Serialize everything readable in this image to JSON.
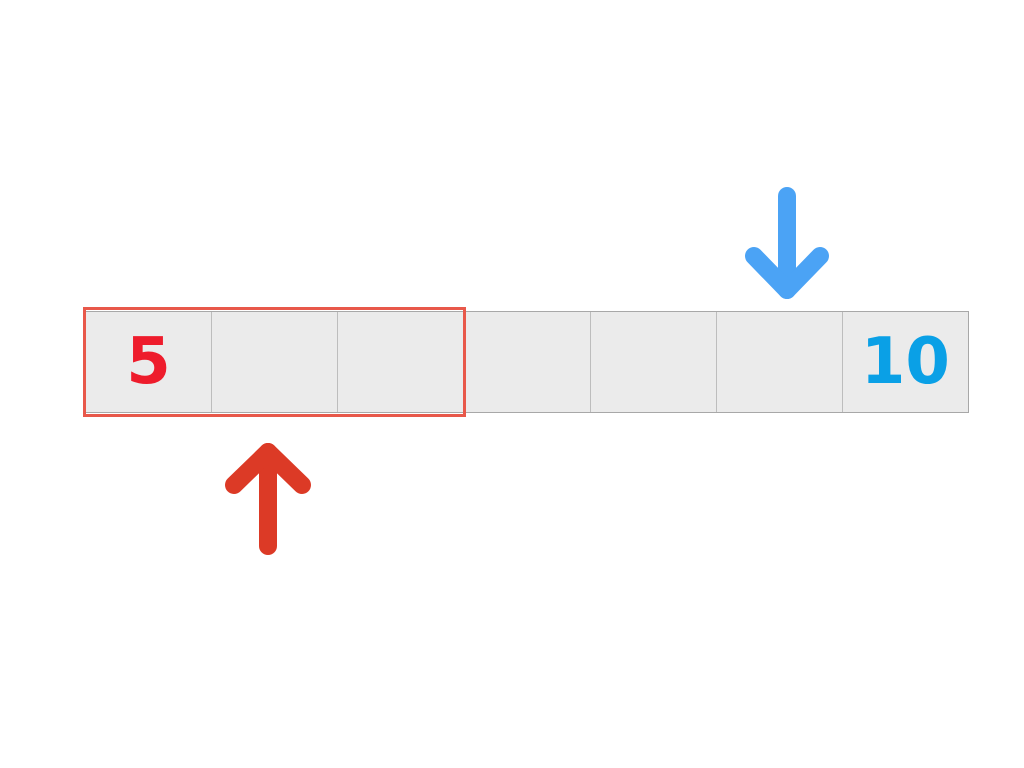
{
  "cells": [
    {
      "value": "5"
    },
    {
      "value": ""
    },
    {
      "value": ""
    },
    {
      "value": ""
    },
    {
      "value": ""
    },
    {
      "value": ""
    },
    {
      "value": "10"
    }
  ],
  "colors": {
    "cell_fill": "#ebebeb",
    "cell_border": "#bdbdbd",
    "left_value": "#ee1c2c",
    "right_value": "#0aa0e6",
    "highlight_box": "#e8584a",
    "up_arrow": "#dc3a26",
    "down_arrow": "#4ba3f5"
  },
  "arrows": [
    {
      "name": "up-arrow-icon",
      "direction": "up"
    },
    {
      "name": "down-arrow-icon",
      "direction": "down"
    }
  ]
}
